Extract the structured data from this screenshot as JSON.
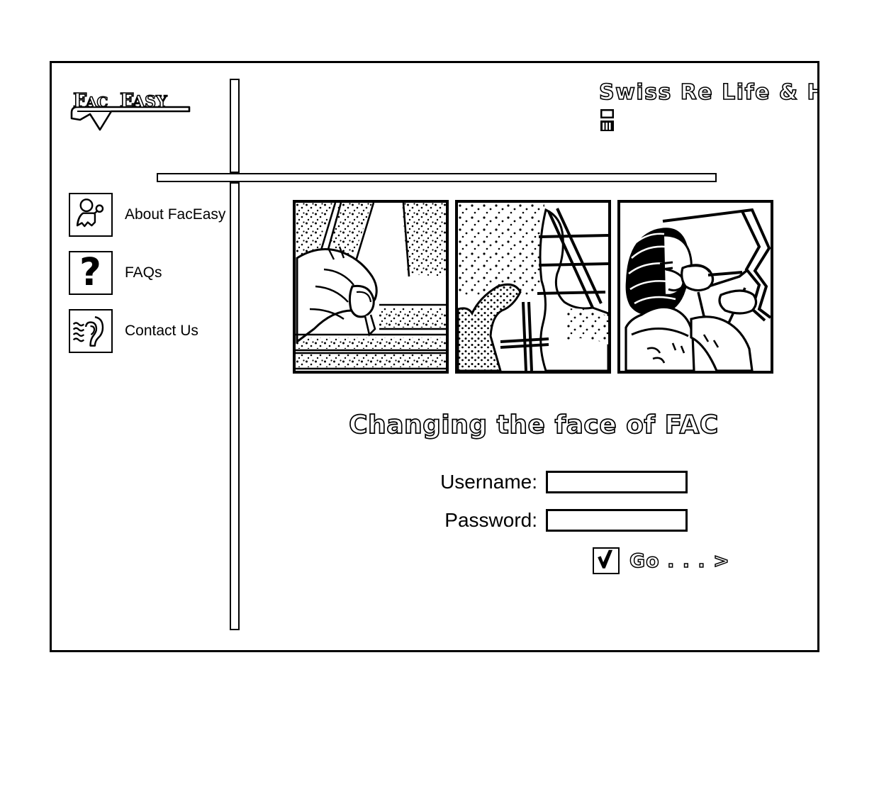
{
  "page": {
    "logo_text": "FAC EASY",
    "logo_icon": "faceasy-wave-logo"
  },
  "header": {
    "brand_text": "Swiss Re Life & Hea",
    "brand_icon": "swissre-monitor-icon"
  },
  "sidebar": {
    "items": [
      {
        "label": "About FacEasy",
        "icon": "person-pointing-icon"
      },
      {
        "label": "FAQs",
        "icon": "question-mark-icon"
      },
      {
        "label": "Contact Us",
        "icon": "ear-soundwaves-icon"
      }
    ]
  },
  "gallery": {
    "panels": [
      {
        "icon": "hand-holding-pen-illustration"
      },
      {
        "icon": "ladder-scaffolding-illustration"
      },
      {
        "icon": "person-at-drafting-table-illustration"
      }
    ]
  },
  "tagline": {
    "text": "Changing the face of FAC"
  },
  "login": {
    "username_label": "Username:",
    "username_value": "",
    "username_placeholder": "",
    "password_label": "Password:",
    "password_value": "",
    "password_placeholder": "",
    "go_label": "Go . . . >",
    "go_icon": "checkmark-icon"
  },
  "colors": {
    "ink": "#000000",
    "paper": "#ffffff"
  }
}
